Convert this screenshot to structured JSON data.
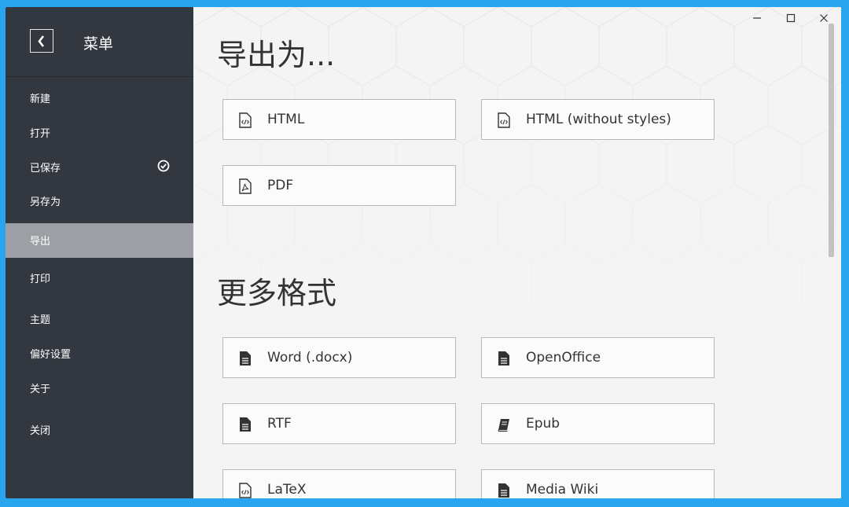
{
  "sidebar": {
    "title": "菜单",
    "items": [
      {
        "label": "新建"
      },
      {
        "label": "打开"
      },
      {
        "label": "已保存"
      },
      {
        "label": "另存为"
      },
      {
        "label": "导出"
      },
      {
        "label": "打印"
      },
      {
        "label": "主题"
      },
      {
        "label": "偏好设置"
      },
      {
        "label": "关于"
      },
      {
        "label": "关闭"
      }
    ]
  },
  "main": {
    "export_title": "导出为...",
    "export_options": [
      {
        "label": "HTML",
        "icon": "code-file-icon"
      },
      {
        "label": "HTML (without styles)",
        "icon": "code-file-icon"
      },
      {
        "label": "PDF",
        "icon": "pdf-file-icon"
      }
    ],
    "more_title": "更多格式",
    "more_options": [
      {
        "label": "Word (.docx)",
        "icon": "document-icon"
      },
      {
        "label": "OpenOffice",
        "icon": "document-icon"
      },
      {
        "label": "RTF",
        "icon": "document-icon"
      },
      {
        "label": "Epub",
        "icon": "book-icon"
      },
      {
        "label": "LaTeX",
        "icon": "code-file-icon"
      },
      {
        "label": "Media Wiki",
        "icon": "document-icon"
      }
    ]
  },
  "colors": {
    "desktop": "#29a5ef",
    "sidebar": "#333840",
    "sidebar_active": "#9c9fa4",
    "main_bg": "#f4f4f4"
  }
}
